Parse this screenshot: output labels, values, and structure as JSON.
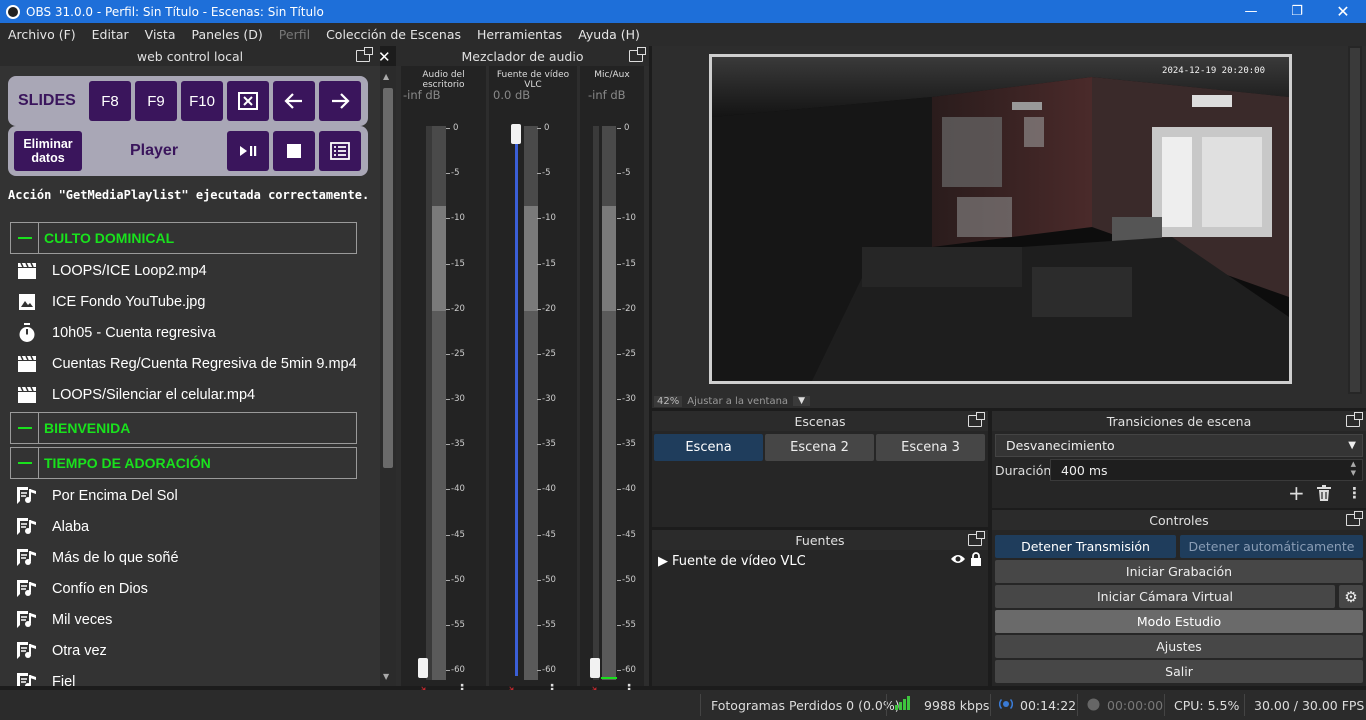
{
  "window": {
    "title": "OBS 31.0.0 - Perfil: Sin Título - Escenas: Sin Título"
  },
  "menu": [
    "Archivo (F)",
    "Editar",
    "Vista",
    "Paneles (D)",
    "Perfil",
    "Colección de Escenas",
    "Herramientas",
    "Ayuda (H)"
  ],
  "web_dock": {
    "title": "web control local",
    "slides_label": "SLIDES",
    "f8": "F8",
    "f9": "F9",
    "f10": "F10",
    "clear_label": "Eliminar datos",
    "player_label": "Player",
    "message": "Acción \"GetMediaPlaylist\" ejecutada correctamente.",
    "groups": [
      "CULTO DOMINICAL",
      "BIENVENIDA",
      "TIEMPO DE ADORACIÓN"
    ],
    "items_culto": [
      {
        "icon": "video-clapper-icon",
        "label": "LOOPS/ICE Loop2.mp4"
      },
      {
        "icon": "image-icon",
        "label": "ICE Fondo YouTube.jpg"
      },
      {
        "icon": "timer-icon",
        "label": "10h05 - Cuenta regresiva"
      },
      {
        "icon": "video-clapper-icon",
        "label": "Cuentas Reg/Cuenta Regresiva de 5min 9.mp4"
      },
      {
        "icon": "video-clapper-icon",
        "label": "LOOPS/Silenciar el celular.mp4"
      }
    ],
    "items_adoracion": [
      {
        "icon": "lyrics-icon",
        "label": "Por Encima Del Sol"
      },
      {
        "icon": "lyrics-icon",
        "label": "Alaba"
      },
      {
        "icon": "lyrics-icon",
        "label": "Más de lo que soñé"
      },
      {
        "icon": "lyrics-icon",
        "label": "Confío en Dios"
      },
      {
        "icon": "lyrics-icon",
        "label": "Mil veces"
      },
      {
        "icon": "lyrics-icon",
        "label": "Otra vez"
      },
      {
        "icon": "lyrics-icon",
        "label": "Fiel"
      }
    ]
  },
  "mixer": {
    "title": "Mezclador de audio",
    "channels": [
      {
        "name": "Audio del escritorio",
        "db": "-inf dB",
        "fader_level": 0.0
      },
      {
        "name": "Fuente de vídeo VLC",
        "db": "0.0 dB",
        "fader_level": 1.0
      },
      {
        "name": "Mic/Aux",
        "db": "-inf dB",
        "fader_level": 0.0
      }
    ],
    "ticks": [
      "0",
      "-5",
      "-10",
      "-15",
      "-20",
      "-25",
      "-30",
      "-35",
      "-40",
      "-45",
      "-50",
      "-55",
      "-60"
    ]
  },
  "preview": {
    "timestamp": "2024-12-19 20:20:00",
    "zoom": "42%",
    "zoom_mode": "Ajustar a la ventana"
  },
  "scenes": {
    "title": "Escenas",
    "items": [
      "Escena",
      "Escena 2",
      "Escena 3"
    ],
    "active": 0
  },
  "sources": {
    "title": "Fuentes",
    "items": [
      "Fuente de vídeo VLC"
    ]
  },
  "transitions": {
    "title": "Transiciones de escena",
    "selected": "Desvanecimiento",
    "duration_label": "Duración",
    "duration": "400 ms"
  },
  "controls": {
    "title": "Controles",
    "stop_stream": "Detener Transmisión",
    "stop_auto": "Detener automáticamente",
    "start_recording": "Iniciar Grabación",
    "start_virtual_cam": "Iniciar Cámara Virtual",
    "studio_mode": "Modo Estudio",
    "settings": "Ajustes",
    "exit": "Salir"
  },
  "status": {
    "dropped": "Fotogramas Perdidos 0 (0.0%)",
    "bitrate": "9988 kbps",
    "stream_time": "00:14:22",
    "rec_time": "00:00:00",
    "cpu": "CPU: 5.5%",
    "fps": "30.00 / 30.00 FPS"
  },
  "colors": {
    "accent": "#1e6fd9",
    "group_green": "#19e11d",
    "button_purple": "#3a155c",
    "mute_red": "#c0282e"
  }
}
